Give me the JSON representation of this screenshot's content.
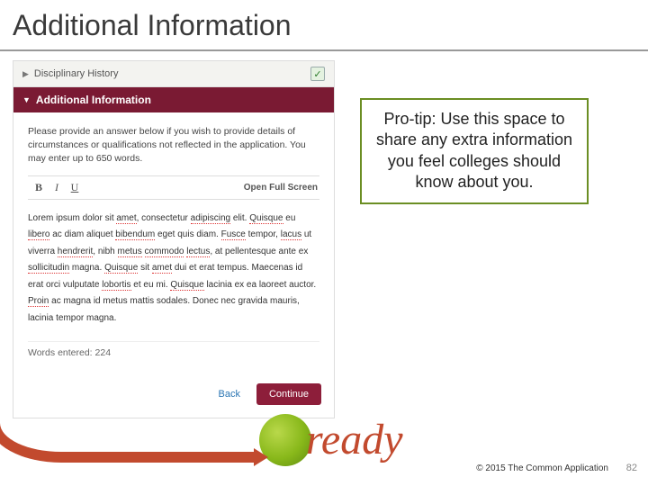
{
  "slide": {
    "title": "Additional Information",
    "page_number": "82",
    "copyright": "© 2015 The Common Application",
    "logo_word": "ready"
  },
  "tip": {
    "text": "Pro-tip: Use this space to share any extra information you feel colleges should know about you."
  },
  "app": {
    "collapsed_section": "Disciplinary History",
    "active_section": "Additional Information",
    "prompt": "Please provide an answer below if you wish to provide details of circumstances or qualifications not reflected in the application. You may enter up to 650 words.",
    "toolbar": {
      "bold": "B",
      "italic": "I",
      "underline": "U",
      "fullscreen": "Open Full Screen"
    },
    "essay_parts": {
      "p1": "Lorem ipsum dolor sit ",
      "w1": "amet",
      "p2": ", consectetur ",
      "w2": "adipiscing",
      "p3": " elit. ",
      "w3": "Quisque",
      "p4": " eu ",
      "w4": "libero",
      "p5": " ac diam aliquet ",
      "w5": "bibendum",
      "p6": " eget quis diam. ",
      "w6": "Fusce",
      "p7": " tempor, ",
      "w7": "lacus",
      "p8": " ut viverra ",
      "w8": "hendrerit",
      "p9": ", nibh ",
      "w9": "metus",
      "p10": " ",
      "w10": "commodo",
      "p11": " ",
      "w11": "lectus",
      "p12": ", at pellentesque ante ex ",
      "w12": "sollicitudin",
      "p13": " magna. ",
      "w13": "Quisque",
      "p14": " sit ",
      "w14": "amet",
      "p15": " dui et erat tempus. Maecenas id erat orci vulputate ",
      "w15": "lobortis",
      "p16": " et eu mi. ",
      "w16": "Quisque",
      "p17": " lacinia ex ea laoreet auctor. ",
      "w17": "Proin",
      "p18": " ac magna id metus mattis sodales. Donec nec gravida mauris, lacinia tempor magna."
    },
    "word_count_label": "Words entered: 224",
    "back_label": "Back",
    "continue_label": "Continue"
  }
}
